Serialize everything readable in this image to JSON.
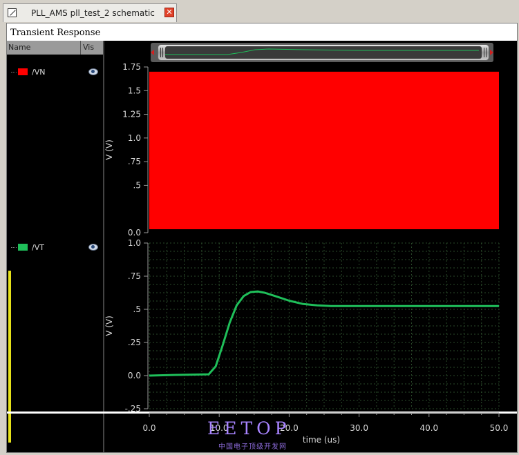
{
  "tab": {
    "title": "PLL_AMS pll_test_2 schematic",
    "close_label": "✕"
  },
  "window": {
    "title": "Transient Response"
  },
  "signal_list": {
    "name_header": "Name",
    "vis_header": "Vis"
  },
  "signals": [
    {
      "label": "/VN",
      "color": "#ff0000"
    },
    {
      "label": "/VT",
      "color": "#1fbf5a"
    }
  ],
  "watermark": {
    "text": "EETOP",
    "subtext": "中国电子顶级开发网"
  },
  "colors": {
    "background": "#000000",
    "grid": "#2a4a2a",
    "vn": "#ff0000",
    "vt": "#1fbf5a",
    "selection_bar": "#e6e21a"
  },
  "chart_data": [
    {
      "type": "area",
      "series": [
        {
          "name": "/VN",
          "x": [
            0.0,
            50.0
          ],
          "y": [
            0.0,
            1.7
          ]
        }
      ],
      "ylabel": "V (V)",
      "ylim": [
        0.0,
        1.75
      ],
      "yticks": [
        "0.0",
        ".5",
        ".75",
        "1.0",
        "1.25",
        "1.5",
        "1.75"
      ],
      "xlim": [
        0.0,
        50.0
      ],
      "note_text": ""
    },
    {
      "type": "line",
      "series": [
        {
          "name": "/VT",
          "x": [
            0,
            4,
            8.5,
            9.5,
            10.5,
            11.5,
            12.5,
            13.5,
            14.5,
            15.5,
            16.5,
            18,
            20,
            22,
            24,
            26,
            28,
            30,
            35,
            40,
            45,
            50
          ],
          "y": [
            0.0,
            0.005,
            0.01,
            0.07,
            0.23,
            0.4,
            0.53,
            0.6,
            0.63,
            0.635,
            0.625,
            0.6,
            0.565,
            0.54,
            0.53,
            0.525,
            0.525,
            0.525,
            0.525,
            0.525,
            0.525,
            0.525
          ]
        }
      ],
      "ylabel": "V (V)",
      "ylim": [
        -0.25,
        1.0
      ],
      "yticks": [
        "-.25",
        "0.0",
        ".25",
        ".5",
        ".75",
        "1.0"
      ],
      "xlabel": "time (us)",
      "xlim": [
        0.0,
        50.0
      ],
      "xticks": [
        "0.0",
        "10.0",
        "20.0",
        "30.0",
        "40.0",
        "50.0"
      ],
      "grid": true
    }
  ]
}
